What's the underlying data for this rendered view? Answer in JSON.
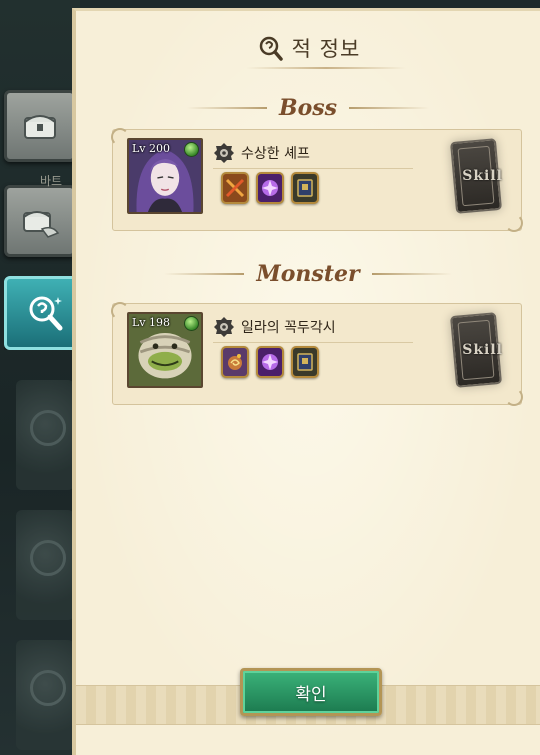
{
  "title": "적 정보",
  "sections": {
    "boss_title": "Boss",
    "monster_title": "Monster"
  },
  "enemies": [
    {
      "level": "Lv 200",
      "name": "수상한 셰프",
      "skill_label": "Skill",
      "skill_icons": [
        "crossed-swords-icon",
        "purple-flower-icon",
        "tome-icon"
      ]
    },
    {
      "level": "Lv 198",
      "name": "일라의 꼭두각시",
      "skill_label": "Skill",
      "skill_icons": [
        "swirl-bomb-icon",
        "purple-flower-icon",
        "tome-icon"
      ]
    }
  ],
  "side_caption": "바트",
  "confirm_label": "확인",
  "colors": {
    "accent_green": "#2c9a66",
    "tab_active": "#2a8f97",
    "parchment": "#f7efd8"
  }
}
